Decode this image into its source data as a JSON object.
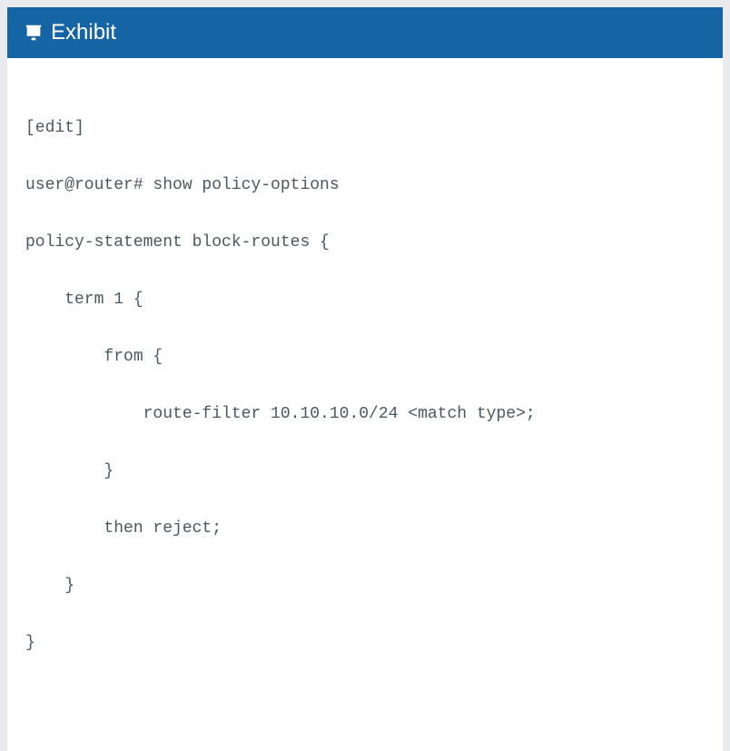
{
  "header": {
    "title": "Exhibit"
  },
  "code": {
    "lines": [
      "[edit]",
      "user@router# show policy-options",
      "policy-statement block-routes {",
      "    term 1 {",
      "        from {",
      "            route-filter 10.10.10.0/24 <match type>;",
      "        }",
      "        then reject;",
      "    }",
      "}"
    ]
  }
}
